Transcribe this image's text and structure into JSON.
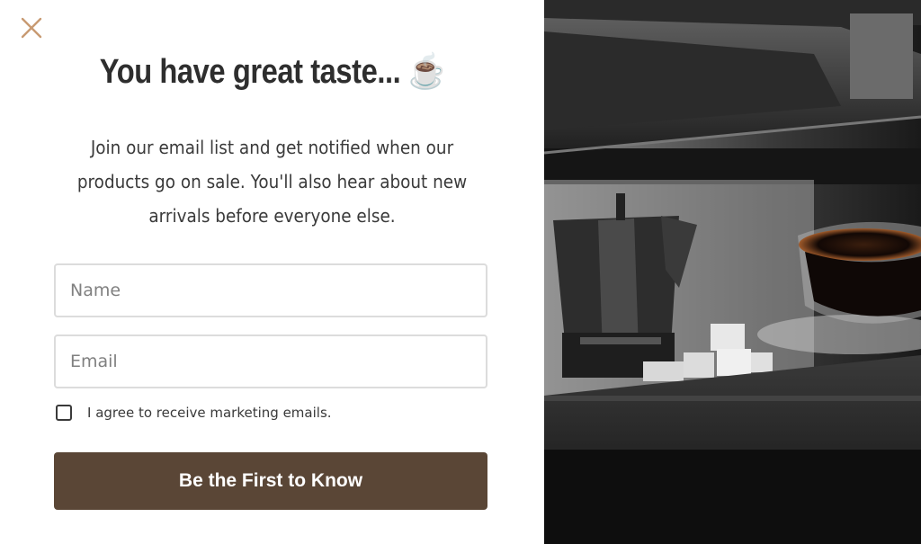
{
  "popup": {
    "close_icon": "close-icon",
    "headline": "You have great taste... ☕",
    "subtext": "Join our email list and get notified when our products go on sale. You'll also hear about new arrivals before everyone else.",
    "form": {
      "name_placeholder": "Name",
      "name_value": "",
      "email_placeholder": "Email",
      "email_value": "",
      "consent_checked": false,
      "consent_label": "I agree to receive marketing emails.",
      "submit_label": "Be the First to Know"
    }
  },
  "colors": {
    "button": "#5a4636",
    "close": "#c89a72",
    "headline": "#2e2e2e"
  },
  "image": {
    "subject": "coffee-moka-pot-and-espresso-cup-on-kitchen-shelf"
  }
}
